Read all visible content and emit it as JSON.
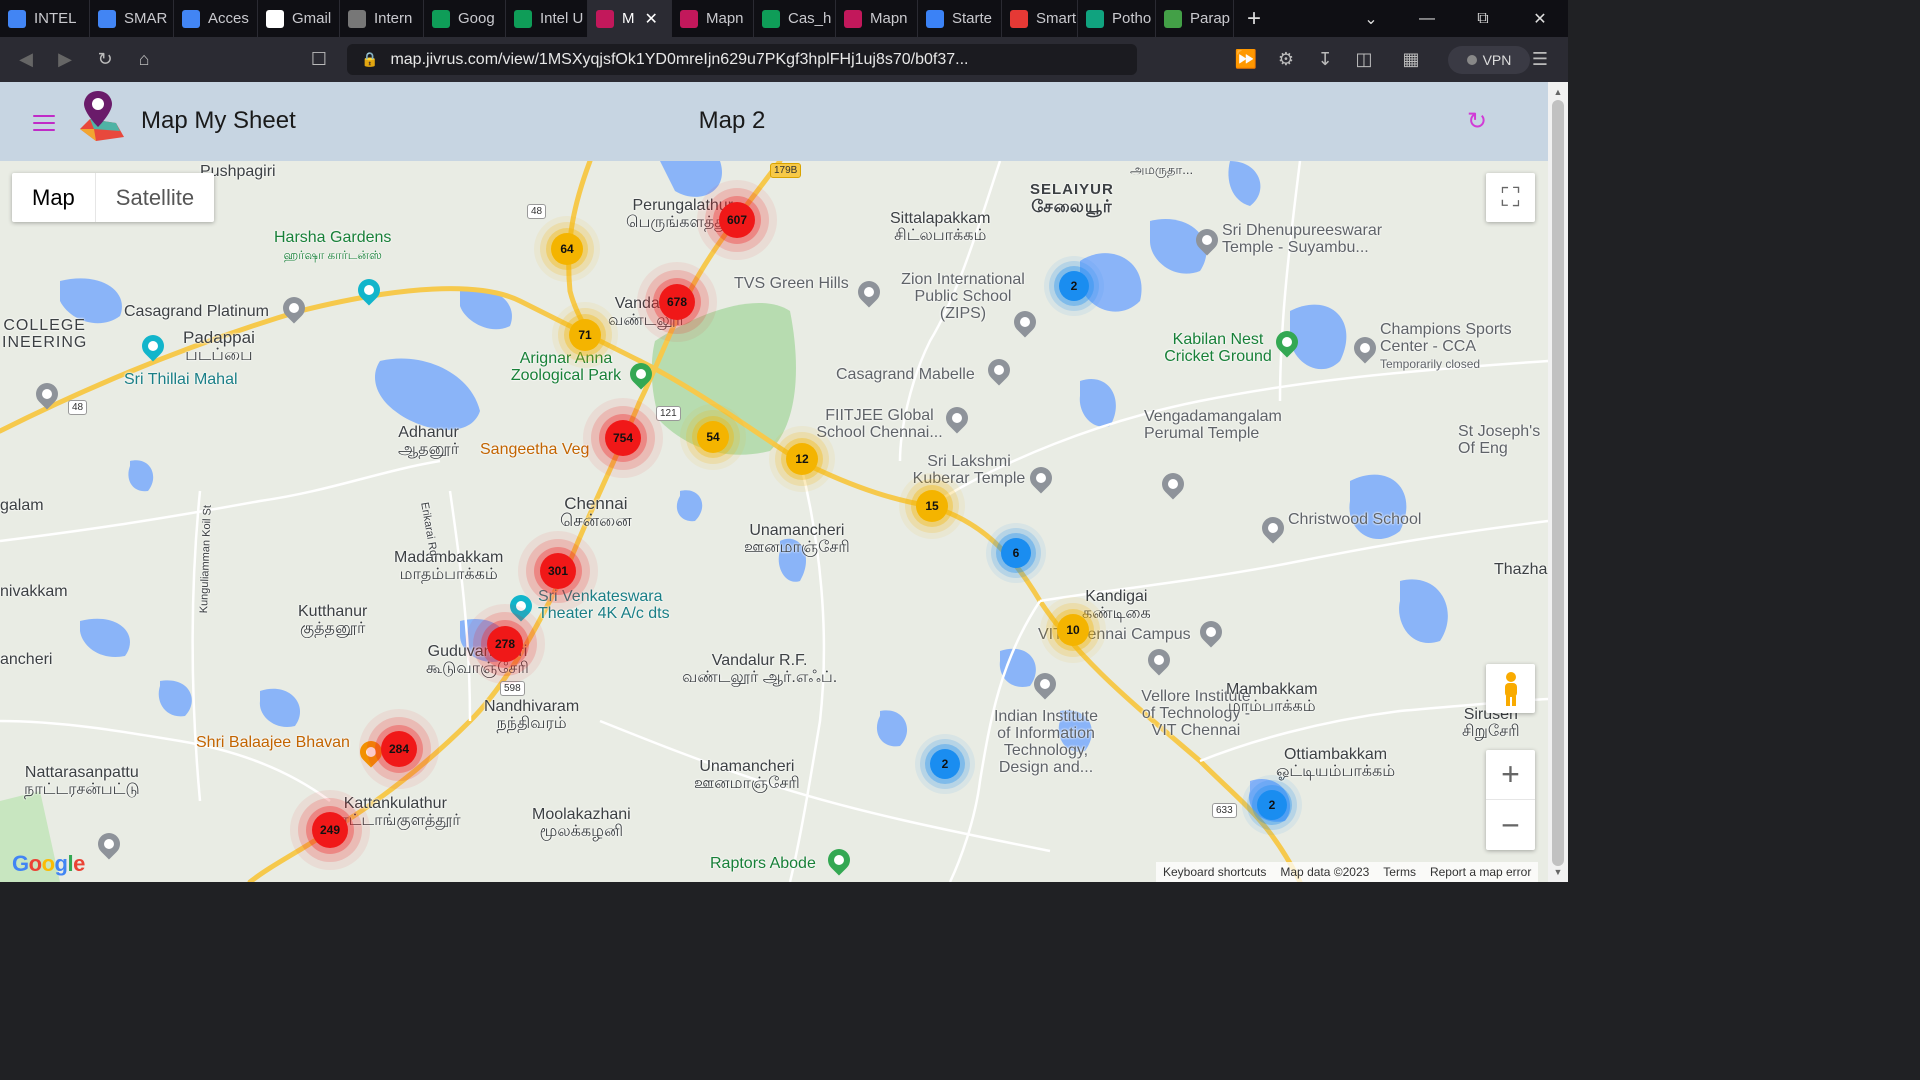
{
  "browser": {
    "tabs": [
      {
        "label": "INTEL",
        "icon": "docs-icon",
        "color": "#4285f4",
        "active": false
      },
      {
        "label": "SMAR",
        "icon": "docs-icon",
        "color": "#4285f4",
        "active": false
      },
      {
        "label": "Acces",
        "icon": "docs-icon",
        "color": "#4285f4",
        "active": false
      },
      {
        "label": "Gmail",
        "icon": "google-icon",
        "color": "#ffffff",
        "active": false
      },
      {
        "label": "Intern",
        "icon": "globe-icon",
        "color": "#777777",
        "active": false
      },
      {
        "label": "Goog",
        "icon": "sheets-icon",
        "color": "#0f9d58",
        "active": false
      },
      {
        "label": "Intel U",
        "icon": "sheets-plus-icon",
        "color": "#0f9d58",
        "active": false
      },
      {
        "label": "M",
        "icon": "mapmysheet-icon",
        "color": "#c2185b",
        "active": true
      },
      {
        "label": "Mapn",
        "icon": "mapmysheet-icon",
        "color": "#c2185b",
        "active": false
      },
      {
        "label": "Cas_h",
        "icon": "sheets-plus-icon",
        "color": "#0f9d58",
        "active": false
      },
      {
        "label": "Mapn",
        "icon": "mapmysheet-icon",
        "color": "#c2185b",
        "active": false
      },
      {
        "label": "Starte",
        "icon": "k-icon",
        "color": "#3b82f6",
        "active": false
      },
      {
        "label": "Smart",
        "icon": "balloon-icon",
        "color": "#e53935",
        "active": false
      },
      {
        "label": "Potho",
        "icon": "openai-icon",
        "color": "#10a37f",
        "active": false
      },
      {
        "label": "Parap",
        "icon": "robot-icon",
        "color": "#43a047",
        "active": false
      }
    ],
    "new_tab": "+",
    "url": "map.jivrus.com/view/1MSXyqjsfOk1YD0mreIjn629u7PKgf3hplFHj1uj8s70/b0f37...",
    "vpn_label": "VPN",
    "brave_badge": "3"
  },
  "app": {
    "title": "Map My Sheet",
    "map_name": "Map 2",
    "accent": "#c02bc7"
  },
  "map_controls": {
    "map_type_options": [
      "Map",
      "Satellite"
    ],
    "selected": "Map",
    "zoom_in": "+",
    "zoom_out": "−",
    "attribution": [
      "Keyboard shortcuts",
      "Map data ©2023",
      "Terms",
      "Report a map error"
    ],
    "google": "Google"
  },
  "clusters": [
    {
      "count": "607",
      "color": "red"
    },
    {
      "count": "64",
      "color": "yellow"
    },
    {
      "count": "678",
      "color": "red"
    },
    {
      "count": "71",
      "color": "yellow"
    },
    {
      "count": "754",
      "color": "red"
    },
    {
      "count": "54",
      "color": "yellow"
    },
    {
      "count": "12",
      "color": "yellow"
    },
    {
      "count": "15",
      "color": "yellow"
    },
    {
      "count": "6",
      "color": "blue"
    },
    {
      "count": "10",
      "color": "yellow"
    },
    {
      "count": "2",
      "color": "blue"
    },
    {
      "count": "301",
      "color": "red"
    },
    {
      "count": "278",
      "color": "red"
    },
    {
      "count": "284",
      "color": "red"
    },
    {
      "count": "249",
      "color": "red"
    },
    {
      "count": "2",
      "color": "blue"
    },
    {
      "count": "2",
      "color": "blue"
    }
  ],
  "places": {
    "pushpagiri": "Pushpagiri",
    "harsha": "Harsha Gardens",
    "harsha_ta": "ஹர்ஷா கார்டன்ஸ்",
    "casagrand_platinum": "Casagrand Platinum",
    "college": "COLLEGE",
    "ineering": "INEERING",
    "padappai": "Padappai",
    "padappai_ta": "படப்பை",
    "sri_thillai": "Sri Thillai Mahal",
    "perungalathur": "Perungalathur",
    "perungalathur_ta": "பெருங்களத்தூர்",
    "vandalur": "Vandalur",
    "vandalur_ta": "வண்டலூர்",
    "arignar": "Arignar Anna Zoological Park",
    "adhanur": "Adhanur",
    "adhanur_ta": "ஆதனூர்",
    "sangeetha": "Sangeetha Veg",
    "chennai": "Chennai",
    "chennai_ta": "சென்னை",
    "madambakkam": "Madambakkam",
    "madambakkam_ta": "மாதம்பாக்கம்",
    "kutthanur": "Kutthanur",
    "kutthanur_ta": "குத்தனூர்",
    "sri_venkateswara": "Sri Venkateswara Theater 4K A/c dts",
    "guduvancheri": "Guduvancheri",
    "guduvancheri_ta": "கூடுவாஞ்சேரி",
    "nandhivaram": "Nandhivaram",
    "nandhivaram_ta": "நந்திவரம்",
    "shri_balaajee": "Shri Balaajee Bhavan",
    "nattarasanpattu": "Nattarasanpattu",
    "nattarasanpattu_ta": "நாட்டரசன்பட்டு",
    "kattankulathur": "Kattankulathur",
    "kattankulathur_ta": "காட்டாங்குளத்தூர்",
    "moolakazhani": "Moolakazhani",
    "moolakazhani_ta": "மூலக்கழனி",
    "unamancheri": "Unamancheri",
    "unamancheri_ta": "ஊனமாஞ்சேரி",
    "vandalur_rf": "Vandalur R.F.",
    "vandalur_rf_ta": "வண்டலூர் ஆர்.எஃப்.",
    "unamancheri2": "Unamancheri",
    "unamancheri2_ta": "ஊனமாஞ்சேரி",
    "raptors": "Raptors Abode",
    "tvs": "TVS Green Hills",
    "selaiyur": "SELAIYUR",
    "selaiyur_ta": "சேலையூர்",
    "sittalapakkam": "Sittalapakkam",
    "sittalapakkam_ta": "சிட்லபாக்கம்",
    "zion": "Zion International Public School (ZIPS)",
    "dhenupureeswarar": "Sri Dhenupureeswarar Temple - Suyambu...",
    "kabilan": "Kabilan Nest Cricket Ground",
    "champions": "Champions Sports Center - CCA",
    "temporarily_closed": "Temporarily closed",
    "casagrand_mabelle": "Casagrand Mabelle",
    "fiitjee": "FIITJEE Global School Chennai...",
    "vengadamangalam": "Vengadamangalam Perumal Temple",
    "st_josephs": "St Joseph's Of Eng",
    "lakshmi": "Sri Lakshmi Kuberar Temple",
    "christwood": "Christwood School",
    "kandigai": "Kandigai",
    "kandigai_ta": "கண்டிகை",
    "vit_campus": "VIT Chennai Campus",
    "vellore": "Vellore Institute of Technology - VIT Chennai",
    "iiit": "Indian Institute of Information Technology, Design and...",
    "mambakkam": "Mambakkam",
    "mambakkam_ta": "மாம்பாக்கம்",
    "ottiambakkam": "Ottiambakkam",
    "ottiambakkam_ta": "ஓட்டியம்பாக்கம்",
    "siruseri": "Siruseri",
    "siruseri_ta": "சிறுசேரி",
    "thazha": "Thazha",
    "galam": "galam",
    "nivakkam": "nivakkam",
    "ancheri": "ancheri",
    "erikarai_rd": "Erikarai Rd",
    "kunguliamman": "Kunguliamman Koil St",
    "amarutha": "அமருதா..."
  },
  "shields": [
    "179B",
    "48",
    "48",
    "121",
    "598",
    "633"
  ]
}
